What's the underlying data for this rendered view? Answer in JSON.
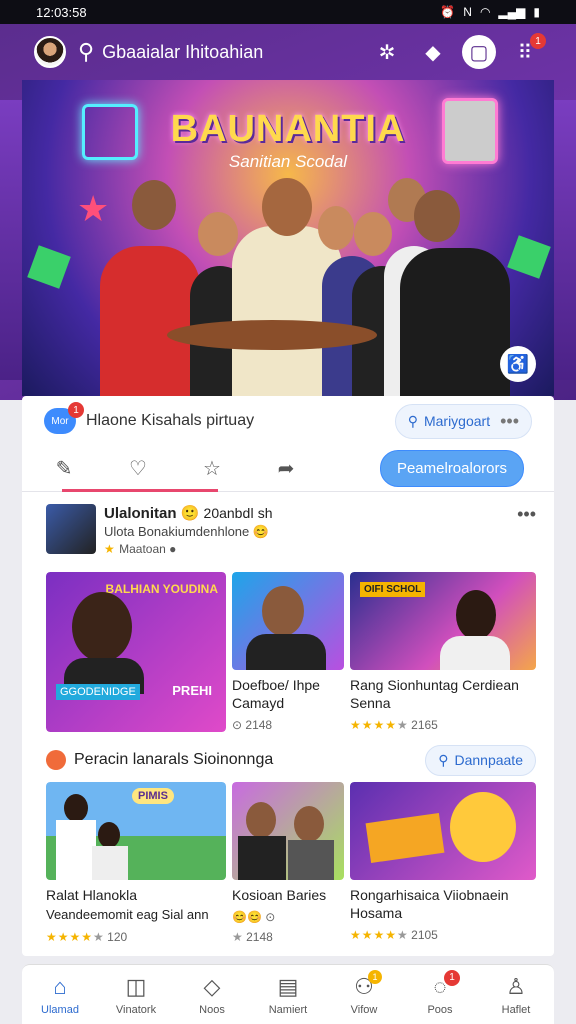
{
  "status": {
    "time": "12:03:58",
    "icons": [
      "alarm-icon",
      "nfc-icon",
      "wifi-icon",
      "signal-icon",
      "battery-icon"
    ]
  },
  "header": {
    "search_text": "Gbaaialar Ihitoahian",
    "notification_badge": "1"
  },
  "hero": {
    "title": "BAUNANTIA",
    "subtitle": "Sanitian Scodal"
  },
  "story": {
    "chat_label": "Mor",
    "chat_badge": "1",
    "title": "Hlaone Kisahals pirtuay",
    "search_label": "Mariygoart",
    "cta_label": "Peamelroalorors"
  },
  "post": {
    "name": "Ulalonitan",
    "time": "20anbdǀ sh",
    "subtitle": "Ulota Bonakiumdenhlone",
    "meta": "Maatoan"
  },
  "row1": [
    {
      "banner": "BALHIAN YOUDINA",
      "badge": "PREHI",
      "title": "",
      "rating": ""
    },
    {
      "title": "Doefboe/ Ihpe Camayd",
      "rating_count": "2148",
      "stars": 0
    },
    {
      "banner": "OIFI SCHOL",
      "title": "Rang Sionhuntag Cerdiean Senna",
      "stars": 4,
      "rating_count": "2165"
    }
  ],
  "section": {
    "title": "Peracin lanarals Sioinonnga",
    "search_label": "Dannpaate"
  },
  "row2": [
    {
      "sign": "PIMIS",
      "title": "Ralat Hlanokla",
      "subtitle": "Veandeemomit eag Sial ann",
      "stars": 4,
      "rating_count": "120"
    },
    {
      "title": "Kosioan Baries",
      "stars": 1,
      "rating_count": "2148"
    },
    {
      "title": "Rongarhisaica Viiobnaein Hosama",
      "stars": 4,
      "rating_count": "2105"
    }
  ],
  "nav": [
    {
      "label": "Ulamad",
      "icon": "home-icon",
      "active": true
    },
    {
      "label": "Vinatork",
      "icon": "camera-icon"
    },
    {
      "label": "Noos",
      "icon": "globe-icon"
    },
    {
      "label": "Namiert",
      "icon": "document-icon"
    },
    {
      "label": "Vifow",
      "icon": "people-icon",
      "badge": "1"
    },
    {
      "label": "Poos",
      "icon": "chat-icon",
      "badge": "1"
    },
    {
      "label": "Haflet",
      "icon": "profile-icon"
    }
  ]
}
